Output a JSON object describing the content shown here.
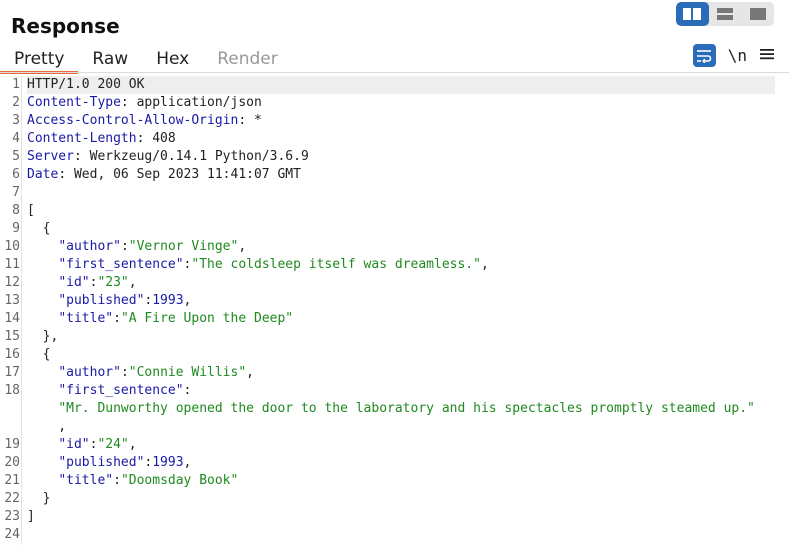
{
  "header": {
    "title": "Response"
  },
  "layout_toggle": {
    "options": [
      "side-by-side",
      "stacked",
      "single"
    ],
    "selected": "side-by-side"
  },
  "tabs": [
    {
      "label": "Pretty",
      "state": "active"
    },
    {
      "label": "Raw",
      "state": "normal"
    },
    {
      "label": "Hex",
      "state": "normal"
    },
    {
      "label": "Render",
      "state": "disabled"
    }
  ],
  "tools": {
    "newline_label": "\\n"
  },
  "colors": {
    "accent": "#2b6cb8",
    "tab_underline": "#e8693a",
    "string": "#1f8a1f",
    "key": "#1a1aa6"
  },
  "lines": [
    {
      "n": "1",
      "parts": [
        [
          "t",
          "HTTP/1.0 200 OK"
        ]
      ]
    },
    {
      "n": "2",
      "parts": [
        [
          "k",
          "Content-Type"
        ],
        [
          "t",
          ": application/json"
        ]
      ]
    },
    {
      "n": "3",
      "parts": [
        [
          "k",
          "Access-Control-Allow-Origin"
        ],
        [
          "t",
          ": *"
        ]
      ]
    },
    {
      "n": "4",
      "parts": [
        [
          "k",
          "Content-Length"
        ],
        [
          "t",
          ": 408"
        ]
      ]
    },
    {
      "n": "5",
      "parts": [
        [
          "k",
          "Server"
        ],
        [
          "t",
          ": Werkzeug/0.14.1 Python/3.6.9"
        ]
      ]
    },
    {
      "n": "6",
      "parts": [
        [
          "k",
          "Date"
        ],
        [
          "t",
          ": Wed, 06 Sep 2023 11:41:07 GMT"
        ]
      ]
    },
    {
      "n": "7",
      "parts": []
    },
    {
      "n": "8",
      "parts": [
        [
          "t",
          "["
        ]
      ]
    },
    {
      "n": "9",
      "parts": [
        [
          "t",
          "  {"
        ]
      ]
    },
    {
      "n": "10",
      "parts": [
        [
          "t",
          "    "
        ],
        [
          "k",
          "\"author\""
        ],
        [
          "t",
          ":"
        ],
        [
          "s",
          "\"Vernor Vinge\""
        ],
        [
          "t",
          ","
        ]
      ]
    },
    {
      "n": "11",
      "parts": [
        [
          "t",
          "    "
        ],
        [
          "k",
          "\"first_sentence\""
        ],
        [
          "t",
          ":"
        ],
        [
          "s",
          "\"The coldsleep itself was dreamless.\""
        ],
        [
          "t",
          ","
        ]
      ]
    },
    {
      "n": "12",
      "parts": [
        [
          "t",
          "    "
        ],
        [
          "k",
          "\"id\""
        ],
        [
          "t",
          ":"
        ],
        [
          "s",
          "\"23\""
        ],
        [
          "t",
          ","
        ]
      ]
    },
    {
      "n": "13",
      "parts": [
        [
          "t",
          "    "
        ],
        [
          "k",
          "\"published\""
        ],
        [
          "t",
          ":"
        ],
        [
          "n",
          "1993"
        ],
        [
          "t",
          ","
        ]
      ]
    },
    {
      "n": "14",
      "parts": [
        [
          "t",
          "    "
        ],
        [
          "k",
          "\"title\""
        ],
        [
          "t",
          ":"
        ],
        [
          "s",
          "\"A Fire Upon the Deep\""
        ]
      ]
    },
    {
      "n": "15",
      "parts": [
        [
          "t",
          "  },"
        ]
      ]
    },
    {
      "n": "16",
      "parts": [
        [
          "t",
          "  {"
        ]
      ]
    },
    {
      "n": "17",
      "parts": [
        [
          "t",
          "    "
        ],
        [
          "k",
          "\"author\""
        ],
        [
          "t",
          ":"
        ],
        [
          "s",
          "\"Connie Willis\""
        ],
        [
          "t",
          ","
        ]
      ]
    },
    {
      "n": "18",
      "parts": [
        [
          "t",
          "    "
        ],
        [
          "k",
          "\"first_sentence\""
        ],
        [
          "t",
          ":"
        ]
      ]
    },
    {
      "n": "",
      "parts": [
        [
          "t",
          "    "
        ],
        [
          "s",
          "\"Mr. Dunworthy opened the door to the laboratory and his spectacles promptly steamed up.\""
        ]
      ]
    },
    {
      "n": "",
      "parts": [
        [
          "t",
          "    ,"
        ]
      ]
    },
    {
      "n": "19",
      "parts": [
        [
          "t",
          "    "
        ],
        [
          "k",
          "\"id\""
        ],
        [
          "t",
          ":"
        ],
        [
          "s",
          "\"24\""
        ],
        [
          "t",
          ","
        ]
      ]
    },
    {
      "n": "20",
      "parts": [
        [
          "t",
          "    "
        ],
        [
          "k",
          "\"published\""
        ],
        [
          "t",
          ":"
        ],
        [
          "n",
          "1993"
        ],
        [
          "t",
          ","
        ]
      ]
    },
    {
      "n": "21",
      "parts": [
        [
          "t",
          "    "
        ],
        [
          "k",
          "\"title\""
        ],
        [
          "t",
          ":"
        ],
        [
          "s",
          "\"Doomsday Book\""
        ]
      ]
    },
    {
      "n": "22",
      "parts": [
        [
          "t",
          "  }"
        ]
      ]
    },
    {
      "n": "23",
      "parts": [
        [
          "t",
          "]"
        ]
      ]
    },
    {
      "n": "24",
      "parts": []
    }
  ]
}
